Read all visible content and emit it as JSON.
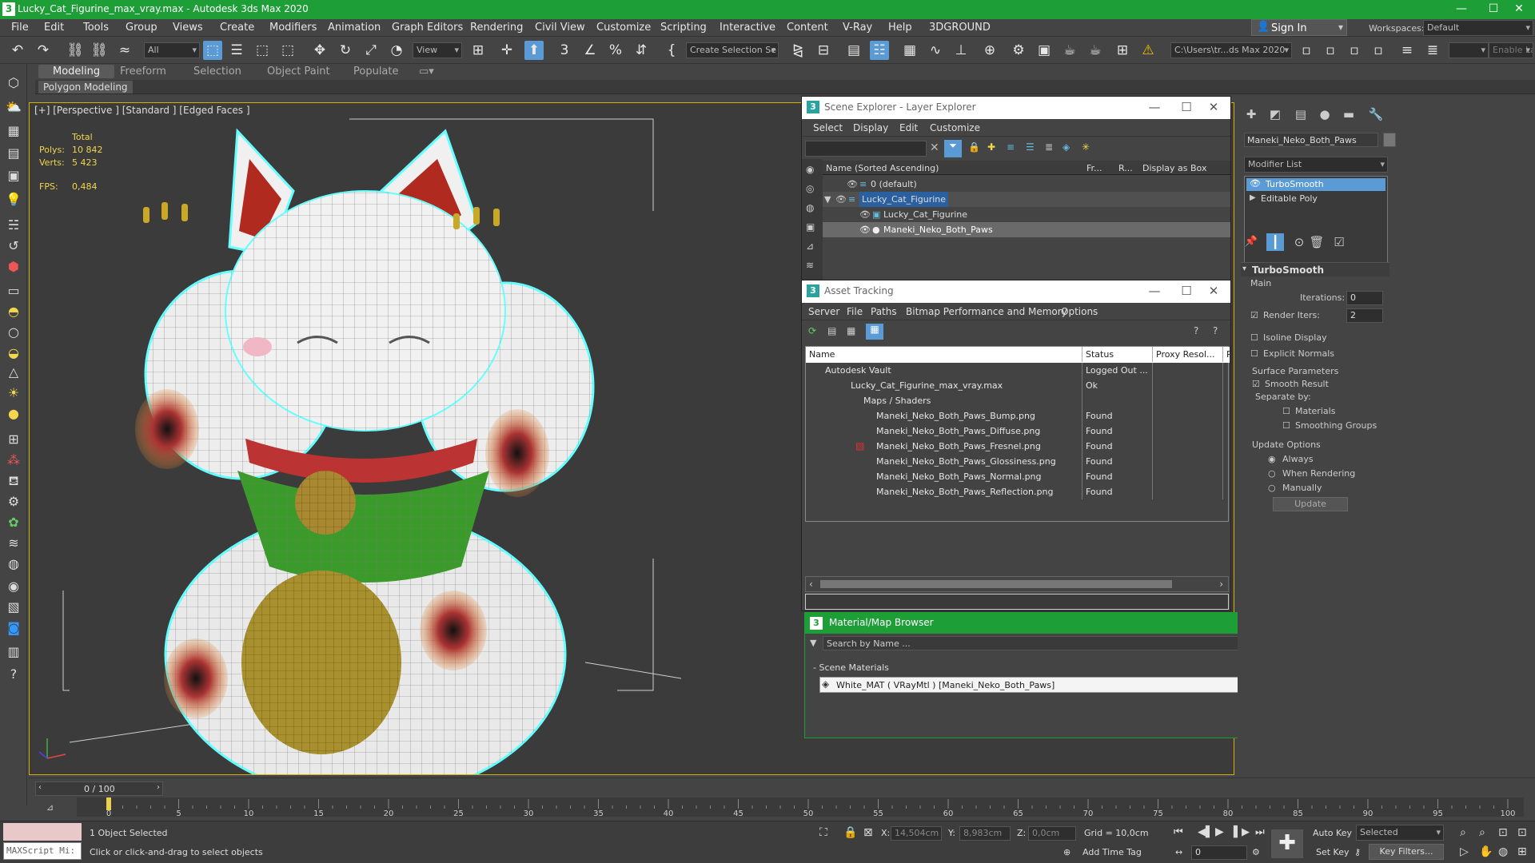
{
  "title": "Lucky_Cat_Figurine_max_vray.max - Autodesk 3ds Max 2020",
  "window_controls": {
    "minimize": "—",
    "maximize": "☐",
    "close": "✕"
  },
  "menu": [
    "File",
    "Edit",
    "Tools",
    "Group",
    "Views",
    "Create",
    "Modifiers",
    "Animation",
    "Graph Editors",
    "Rendering",
    "Civil View",
    "Customize",
    "Scripting",
    "Interactive",
    "Content",
    "V-Ray",
    "Help",
    "3DGROUND"
  ],
  "sign_in": "Sign In",
  "workspaces": {
    "label": "Workspaces:",
    "value": "Default"
  },
  "toolbar": {
    "selection_filter": "All",
    "ref_coord": "View",
    "named_selection": "Create Selection Se",
    "project_path": "C:\\Users\\tr...ds Max 2020",
    "enable_layer": "Enable Lay"
  },
  "ribbon_tabs": [
    "Modeling",
    "Freeform",
    "Selection",
    "Object Paint",
    "Populate"
  ],
  "polygon_modeling": "Polygon Modeling",
  "viewport": {
    "label": "[+] [Perspective ] [Standard ] [Edged Faces ]",
    "stats": {
      "total_label": "Total",
      "polys_label": "Polys:",
      "polys_value": "10 842",
      "verts_label": "Verts:",
      "verts_value": "5 423",
      "fps_label": "FPS:",
      "fps_value": "0,484"
    }
  },
  "scene_explorer": {
    "title": "Scene Explorer - Layer Explorer",
    "menu": [
      "Select",
      "Display",
      "Edit",
      "Customize"
    ],
    "columns": {
      "name": "Name (Sorted Ascending)",
      "freeze": "Fr...",
      "render": "R...",
      "box": "Display as Box"
    },
    "rows": [
      {
        "name": "0 (default)"
      },
      {
        "name": "Lucky_Cat_Figurine"
      },
      {
        "name": "Lucky_Cat_Figurine"
      },
      {
        "name": "Maneki_Neko_Both_Paws"
      }
    ]
  },
  "asset_tracking": {
    "title": "Asset Tracking",
    "menu": [
      "Server",
      "File",
      "Paths",
      "Bitmap Performance and Memory",
      "Options"
    ],
    "columns": {
      "name": "Name",
      "status": "Status",
      "proxy": "Proxy Resol...",
      "p": "P"
    },
    "rows": [
      {
        "name": "Autodesk Vault",
        "status": "Logged Out ..."
      },
      {
        "name": "Lucky_Cat_Figurine_max_vray.max",
        "status": "Ok"
      },
      {
        "name": "Maps / Shaders",
        "status": ""
      },
      {
        "name": "Maneki_Neko_Both_Paws_Bump.png",
        "status": "Found"
      },
      {
        "name": "Maneki_Neko_Both_Paws_Diffuse.png",
        "status": "Found"
      },
      {
        "name": "Maneki_Neko_Both_Paws_Fresnel.png",
        "status": "Found"
      },
      {
        "name": "Maneki_Neko_Both_Paws_Glossiness.png",
        "status": "Found"
      },
      {
        "name": "Maneki_Neko_Both_Paws_Normal.png",
        "status": "Found"
      },
      {
        "name": "Maneki_Neko_Both_Paws_Reflection.png",
        "status": "Found"
      }
    ]
  },
  "material_browser": {
    "title": "Material/Map Browser",
    "search_placeholder": "Search by Name ...",
    "section": "- Scene Materials",
    "material": "White_MAT  ( VRayMtl )  [Maneki_Neko_Both_Paws]"
  },
  "command_panel": {
    "object_name": "Maneki_Neko_Both_Paws",
    "modifier_list": "Modifier List",
    "stack": [
      "TurboSmooth",
      "Editable Poly"
    ],
    "rollout_title": "TurboSmooth",
    "main_label": "Main",
    "iterations_label": "Iterations:",
    "iterations_value": "0",
    "render_iters_label": "Render Iters:",
    "render_iters_value": "2",
    "isoline": "Isoline Display",
    "explicit_normals": "Explicit Normals",
    "surface_params": "Surface Parameters",
    "smooth_result": "Smooth Result",
    "separate_by": "Separate by:",
    "materials": "Materials",
    "smoothing_groups": "Smoothing Groups",
    "update_options": "Update Options",
    "always": "Always",
    "when_rendering": "When Rendering",
    "manually": "Manually",
    "update_button": "Update"
  },
  "timeline": {
    "frame": "0 / 100",
    "ticks": [
      "0",
      "5",
      "10",
      "15",
      "20",
      "25",
      "30",
      "35",
      "40",
      "45",
      "50",
      "55",
      "60",
      "65",
      "70",
      "75",
      "80",
      "85",
      "90",
      "95",
      "100"
    ],
    "current_frame_fraction": 0.0
  },
  "status": {
    "maxscript": "MAXScript Mi:",
    "selected": "1 Object Selected",
    "prompt": "Click or click-and-drag to select objects",
    "x_label": "X:",
    "x_value": "14,504cm",
    "y_label": "Y:",
    "y_value": "8,983cm",
    "z_label": "Z:",
    "z_value": "0,0cm",
    "grid": "Grid = 10,0cm",
    "add_time_tag": "Add Time Tag",
    "auto_key": "Auto Key",
    "selected_dd": "Selected",
    "set_key": "Set Key",
    "key_filters": "Key Filters...",
    "frame_value": "0"
  }
}
